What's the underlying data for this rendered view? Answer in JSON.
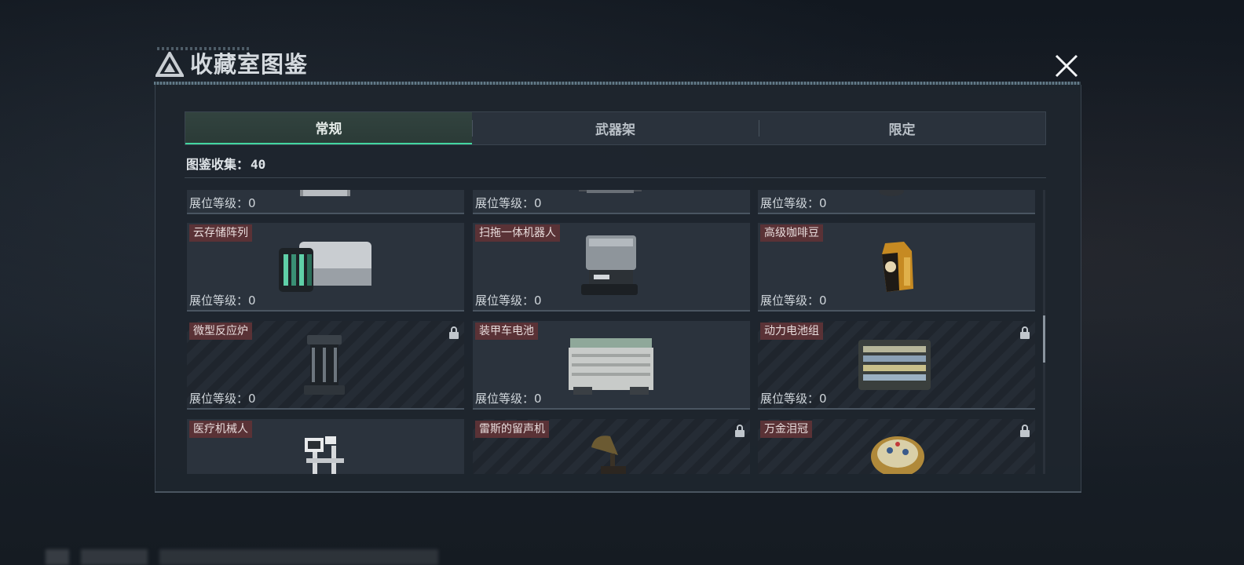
{
  "modal": {
    "title": "收藏室图鉴"
  },
  "tabs": [
    {
      "label": "常规",
      "active": true
    },
    {
      "label": "武器架",
      "active": false
    },
    {
      "label": "限定",
      "active": false
    }
  ],
  "collection": {
    "label": "图鉴收集：",
    "count": "40"
  },
  "level_label": "展位等级：",
  "items": [
    {
      "name": "",
      "level": "0",
      "locked": false,
      "icon": "appliance-icon"
    },
    {
      "name": "",
      "level": "0",
      "locked": false,
      "icon": "machine-icon"
    },
    {
      "name": "",
      "level": "0",
      "locked": false,
      "icon": "device-icon"
    },
    {
      "name": "云存储阵列",
      "level": "0",
      "locked": false,
      "icon": "storage-array-icon"
    },
    {
      "name": "扫拖一体机器人",
      "level": "0",
      "locked": false,
      "icon": "robot-vacuum-icon"
    },
    {
      "name": "高级咖啡豆",
      "level": "0",
      "locked": false,
      "icon": "coffee-bag-icon"
    },
    {
      "name": "微型反应炉",
      "level": "0",
      "locked": true,
      "icon": "reactor-icon"
    },
    {
      "name": "装甲车电池",
      "level": "0",
      "locked": false,
      "icon": "vehicle-battery-icon"
    },
    {
      "name": "动力电池组",
      "level": "0",
      "locked": true,
      "icon": "battery-pack-icon"
    },
    {
      "name": "医疗机械人",
      "level": "",
      "locked": false,
      "icon": "medical-robot-icon"
    },
    {
      "name": "雷斯的留声机",
      "level": "",
      "locked": true,
      "icon": "gramophone-icon"
    },
    {
      "name": "万金泪冠",
      "level": "",
      "locked": true,
      "icon": "jeweled-crown-icon"
    }
  ]
}
